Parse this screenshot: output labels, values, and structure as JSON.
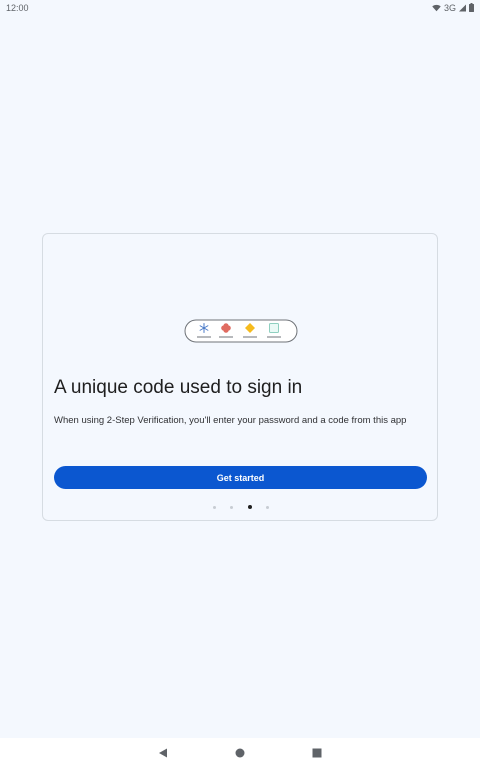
{
  "status_bar": {
    "time": "12:00",
    "network": "3G",
    "icons": [
      "wifi-icon",
      "signal-icon",
      "battery-icon"
    ]
  },
  "onboarding": {
    "title": "A unique code used to sign in",
    "description": "When using 2-Step Verification, you'll enter your password and a code from this app",
    "primary_button": "Get started",
    "pages": 4,
    "current_page": 3
  },
  "illustration": {
    "icons": [
      "asterisk-icon",
      "flower-icon",
      "diamond-icon",
      "square-icon"
    ],
    "colors": {
      "asterisk": "#4a7ac8",
      "flower": "#e06b60",
      "diamond": "#f6bb1d",
      "square": "#8fd0c0"
    }
  },
  "nav_bar": {
    "buttons": [
      "back-icon",
      "home-icon",
      "recents-icon"
    ]
  },
  "colors": {
    "accent": "#0b57d0",
    "background": "#f4f8fe"
  }
}
